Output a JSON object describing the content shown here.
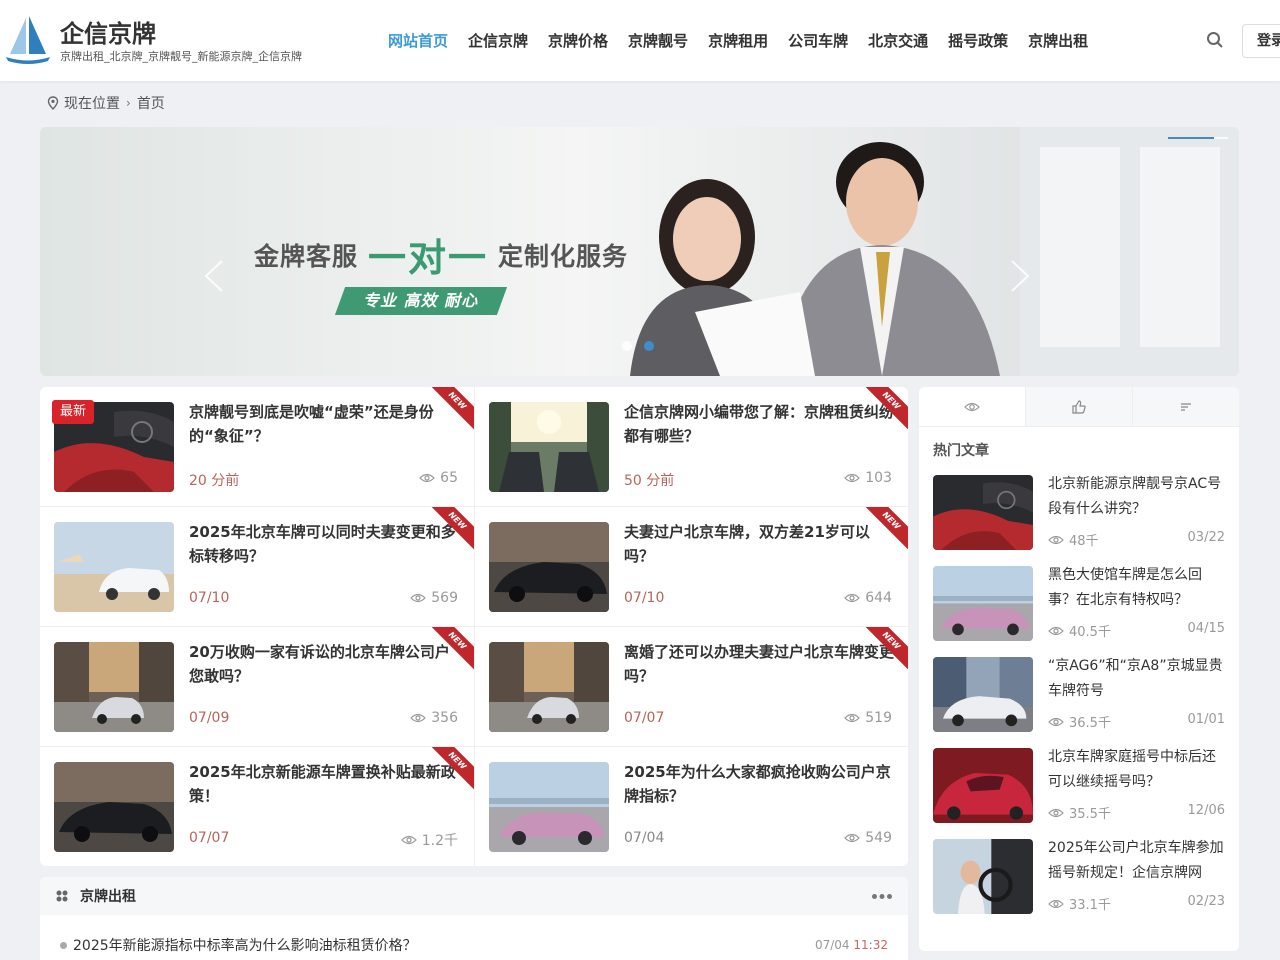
{
  "site": {
    "title": "企信京牌",
    "subtitle": "京牌出租_北京牌_京牌靓号_新能源京牌_企信京牌"
  },
  "nav": {
    "items": [
      "网站首页",
      "企信京牌",
      "京牌价格",
      "京牌靓号",
      "京牌租用",
      "公司车牌",
      "北京交通",
      "摇号政策",
      "京牌出租"
    ],
    "active_index": 0,
    "login_label": "登录"
  },
  "breadcrumb": {
    "location_label": "现在位置",
    "current": "首页"
  },
  "banner": {
    "title_left": "金牌客服",
    "title_mid": "一对一",
    "title_right": "定制化服务",
    "tag": "专业 高效 耐心",
    "slide_count": 2,
    "active_slide": 1
  },
  "articles": [
    {
      "title": "京牌靓号到底是吹嘘“虚荣”还是身份的“象征”？",
      "time": "20 分前",
      "views": "65",
      "ribbon": "NEW",
      "badge": "最新",
      "thumb": "interior"
    },
    {
      "title": "企信京牌网小编带您了解：京牌租赁纠纷都有哪些？",
      "time": "50 分前",
      "views": "103",
      "ribbon": "NEW",
      "badge": "",
      "thumb": "sunroof"
    },
    {
      "title": "2025年北京车牌可以同时夫妻变更和多标转移吗？",
      "time": "07/10",
      "views": "569",
      "ribbon": "NEW",
      "badge": "",
      "thumb": "beach"
    },
    {
      "title": "夫妻过户北京车牌，双方差21岁可以吗？",
      "time": "07/10",
      "views": "644",
      "ribbon": "NEW",
      "badge": "",
      "thumb": "blackcar"
    },
    {
      "title": "20万收购一家有诉讼的北京车牌公司户您敢吗？",
      "time": "07/09",
      "views": "356",
      "ribbon": "NEW",
      "badge": "",
      "thumb": "street"
    },
    {
      "title": "离婚了还可以办理夫妻过户北京车牌变更吗？",
      "time": "07/07",
      "views": "519",
      "ribbon": "NEW",
      "badge": "",
      "thumb": "street"
    },
    {
      "title": "2025年北京新能源车牌置换补贴最新政策！",
      "time": "07/07",
      "views": "1.2千",
      "ribbon": "NEW",
      "badge": "",
      "thumb": "blackcar"
    },
    {
      "title": "2025年为什么大家都疯抢收购公司户京牌指标？",
      "time": "07/04",
      "views": "549",
      "ribbon": "",
      "badge": "",
      "thumb": "pinkcar"
    }
  ],
  "rental": {
    "title": "京牌出租",
    "item": {
      "title": "2025年新能源指标中标率高为什么影响油标租赁价格？",
      "date": "07/04",
      "time": "11:32"
    }
  },
  "sidebar": {
    "section_title": "热门文章",
    "hot": [
      {
        "title": "北京新能源京牌靓号京AC号段有什么讲究？",
        "views": "48千",
        "date": "03/22",
        "thumb": "interior"
      },
      {
        "title": "黑色大使馆车牌是怎么回事？在北京有特权吗？",
        "views": "40.5千",
        "date": "04/15",
        "thumb": "pinkcar"
      },
      {
        "title": "“京AG6”和“京A8”京城显贵车牌符号",
        "views": "36.5千",
        "date": "01/01",
        "thumb": "whitecar"
      },
      {
        "title": "北京车牌家庭摇号中标后还可以继续摇号吗？",
        "views": "35.5千",
        "date": "12/06",
        "thumb": "redcar"
      },
      {
        "title": "2025年公司户北京车牌参加摇号新规定！企信京牌网",
        "views": "33.1千",
        "date": "02/23",
        "thumb": "driver"
      }
    ]
  },
  "colors": {
    "accent": "#3d9bd6",
    "ribbon": "#c0272d",
    "banner_green": "#3a9a72"
  }
}
